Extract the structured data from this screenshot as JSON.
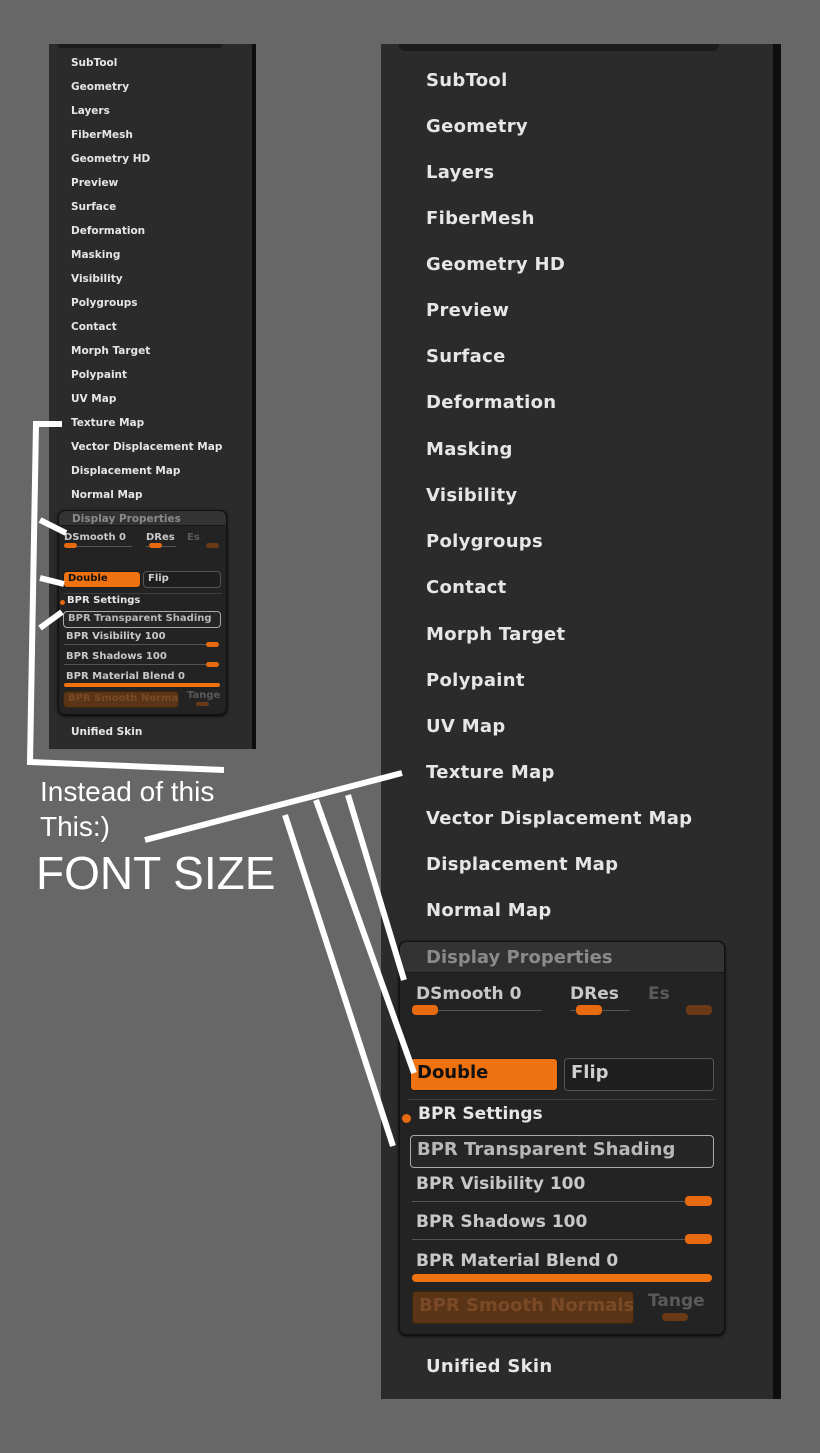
{
  "menu": {
    "items": [
      "SubTool",
      "Geometry",
      "Layers",
      "FiberMesh",
      "Geometry HD",
      "Preview",
      "Surface",
      "Deformation",
      "Masking",
      "Visibility",
      "Polygroups",
      "Contact",
      "Morph Target",
      "Polypaint",
      "UV Map",
      "Texture Map",
      "Vector Displacement Map",
      "Displacement Map",
      "Normal Map"
    ],
    "unified_skin": "Unified Skin"
  },
  "display_properties": {
    "title": "Display Properties",
    "dsmooth": "DSmooth 0",
    "dres": "DRes",
    "es": "Es",
    "double": "Double",
    "flip": "Flip",
    "bpr_settings": "BPR Settings",
    "bpr_transparent": "BPR Transparent Shading",
    "bpr_visibility": "BPR Visibility 100",
    "bpr_shadows": "BPR Shadows 100",
    "bpr_material_blend": "BPR Material Blend 0",
    "bpr_smooth_normals": "BPR Smooth Normals",
    "tange": "Tange"
  },
  "annotation": {
    "line1": "Instead of this",
    "line2": "This:)",
    "line3": "FONT SIZE"
  },
  "colors": {
    "accent": "#ef7210",
    "panel": "#2b2b2b",
    "background": "#676767"
  }
}
